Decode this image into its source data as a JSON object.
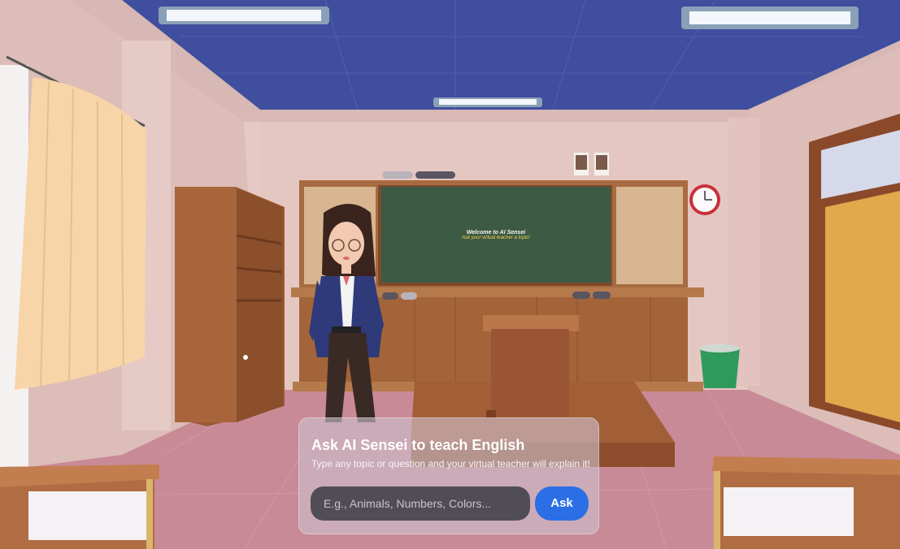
{
  "blackboard": {
    "title": "Welcome to AI Sensei",
    "subtitle": "Ask your virtual teacher a topic!"
  },
  "board_controls": {
    "left_pill_1": "",
    "left_pill_2": "",
    "bottom_pill_1": "",
    "bottom_pill_2": "",
    "right_pill_1": "",
    "right_pill_2": ""
  },
  "ask_panel": {
    "title": "Ask AI Sensei to teach English",
    "subtitle": "Type any topic or question and your virtual teacher will explain it!",
    "input_placeholder": "E.g., Animals, Numbers, Colors...",
    "ask_button": "Ask"
  },
  "colors": {
    "ask_button": "#2b6ee6",
    "ceiling": "#3e4c9c",
    "chalkboard": "#3d5a44"
  }
}
